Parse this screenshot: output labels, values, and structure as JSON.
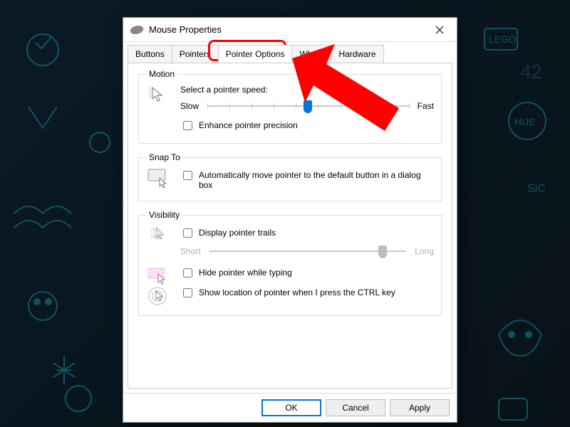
{
  "window": {
    "title": "Mouse Properties"
  },
  "tabs": [
    "Buttons",
    "Pointers",
    "Pointer Options",
    "Wheel",
    "Hardware"
  ],
  "activeTab": 2,
  "motion": {
    "legend": "Motion",
    "label": "Select a pointer speed:",
    "slow": "Slow",
    "fast": "Fast",
    "speed_value": 5,
    "speed_max": 10,
    "enhance": {
      "label": "Enhance pointer precision",
      "checked": false
    }
  },
  "snapto": {
    "legend": "Snap To",
    "auto": {
      "label": "Automatically move pointer to the default button in a dialog box",
      "checked": false
    }
  },
  "visibility": {
    "legend": "Visibility",
    "trails": {
      "label": "Display pointer trails",
      "checked": false
    },
    "short": "Short",
    "long": "Long",
    "trail_value": 9,
    "trail_max": 10,
    "hide": {
      "label": "Hide pointer while typing",
      "checked": false
    },
    "ctrl": {
      "label": "Show location of pointer when I press the CTRL key",
      "checked": false
    }
  },
  "buttons": {
    "ok": "OK",
    "cancel": "Cancel",
    "apply": "Apply"
  },
  "annotation": {
    "highlight_tab": "Pointer Options"
  }
}
